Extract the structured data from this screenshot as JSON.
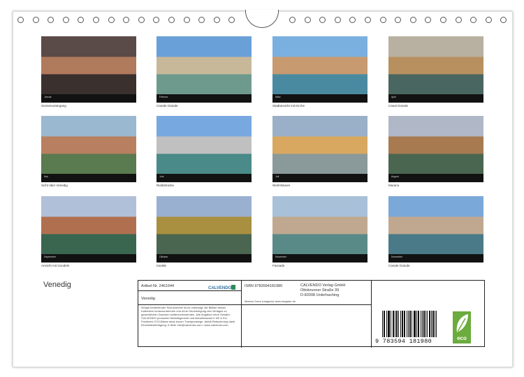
{
  "title": "Venedig",
  "months": [
    {
      "month": "Januar",
      "caption": "Sonnenuntergang"
    },
    {
      "month": "Februar",
      "caption": "Canale Grande"
    },
    {
      "month": "März",
      "caption": "Stadtansicht mit Kirche"
    },
    {
      "month": "April",
      "caption": "Canal Grande"
    },
    {
      "month": "Mai",
      "caption": "Sicht über Venedig"
    },
    {
      "month": "Juni",
      "caption": "Rialtobrücke"
    },
    {
      "month": "Juli",
      "caption": "Wohnhäuser"
    },
    {
      "month": "August",
      "caption": "Murano"
    },
    {
      "month": "September",
      "caption": "Ansicht mit Gondeln"
    },
    {
      "month": "Oktober",
      "caption": "Kanäle"
    },
    {
      "month": "November",
      "caption": "Fassade"
    },
    {
      "month": "Dezember",
      "caption": "Canale Grande"
    }
  ],
  "info": {
    "article": "Artikel-Nr. 2461944",
    "brand": "CALVENDO",
    "product_title": "Venedig",
    "legal_text": "Infolge bestehender Schutzrechte ist es untersagt, die Blätter dieses Kalenders herauszutrennen und ohne Genehmigung des Verlages zu gewerblichen Zwecken weiterzuverwenden. Alle Angaben ohne Gewähr. CALVENDO produziert bedarfsgerecht und klimabewusst in DE & EU. Positivers CO2-Bilanz dank kurzer Transportwege. Abfall-Reduzierung dank Einzelstückfertigung. E-Mail: info@calvendo.com • www.calvendo.com",
    "isbn": "ISBN 9783594181980",
    "publisher": [
      "CALVENDO Verlag GmbH",
      "Ottobrunner Straße 39",
      "D-82008 Unterhaching"
    ],
    "author": "Markus Gann (magann) www.magann.de",
    "barcode_number": "9 783594 181980",
    "eco_label": "eco"
  }
}
